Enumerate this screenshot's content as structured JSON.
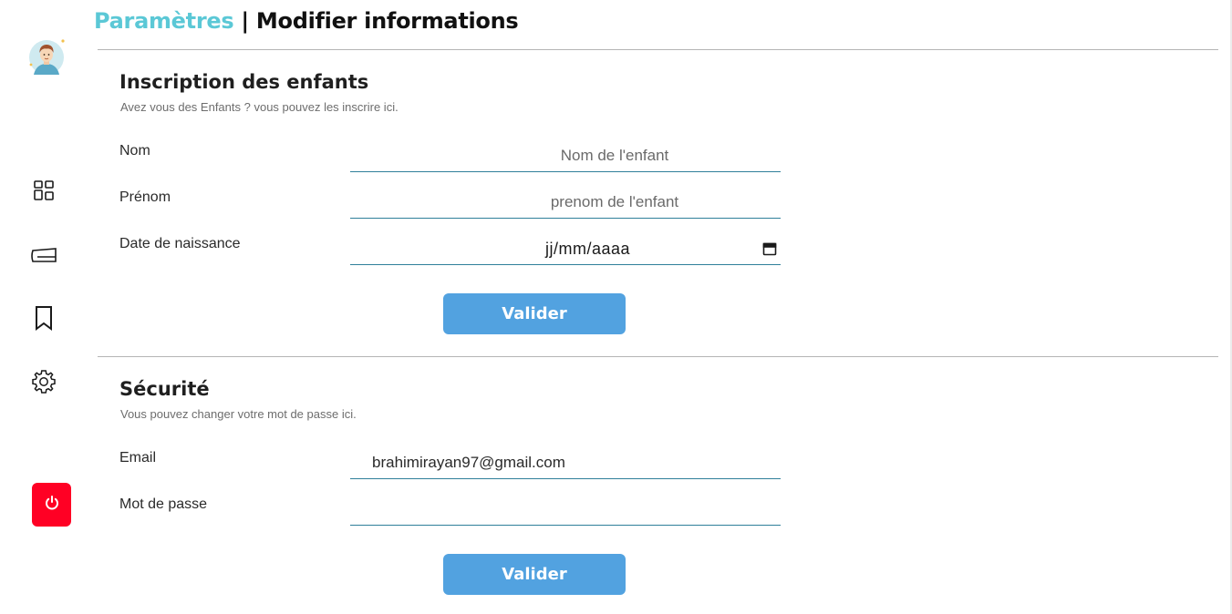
{
  "header": {
    "section": "Paramètres",
    "separator": " | ",
    "subtitle": "Modifier informations"
  },
  "sidebar": {
    "items": [
      {
        "icon": "dashboard-icon"
      },
      {
        "icon": "ticket-icon"
      },
      {
        "icon": "bookmark-icon"
      },
      {
        "icon": "gear-icon"
      }
    ],
    "logout_icon": "power-icon",
    "logout_color": "#ff0024"
  },
  "children_form": {
    "title": "Inscription des enfants",
    "subtitle": "Avez vous des Enfants ? vous pouvez les inscrire ici.",
    "fields": {
      "nom_label": "Nom",
      "nom_placeholder": "Nom de l'enfant",
      "prenom_label": "Prénom",
      "prenom_placeholder": "prenom de l'enfant",
      "birth_label": "Date de naissance",
      "birth_value": "jj/mm/aaaa"
    },
    "submit_label": "Valider"
  },
  "security_form": {
    "title": "Sécurité",
    "subtitle": "Vous pouvez changer votre mot de passe ici.",
    "fields": {
      "email_label": "Email",
      "email_value": "brahimirayan97@gmail.com",
      "password_label": "Mot de passe",
      "password_value": ""
    },
    "submit_label": "Valider"
  },
  "colors": {
    "accent": "#5bc8d6",
    "button": "#52a2e0",
    "input_underline": "#2f7f9a"
  }
}
